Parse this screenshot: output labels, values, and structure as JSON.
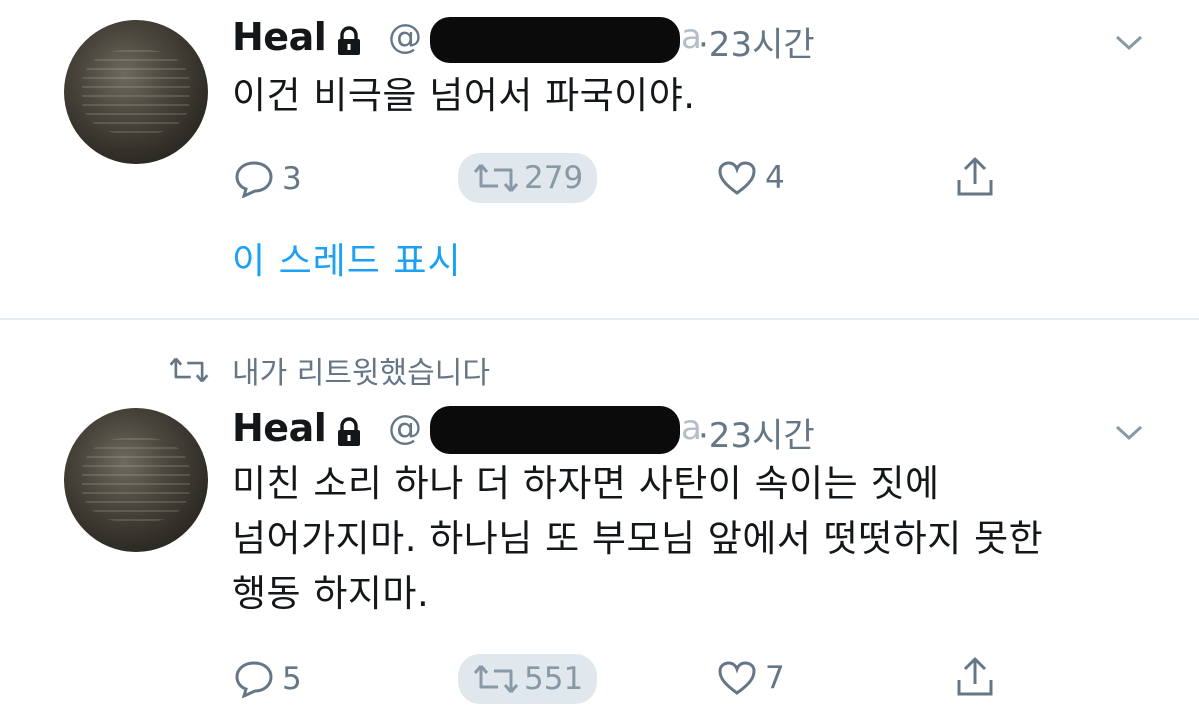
{
  "tweets": [
    {
      "author_name": "Heal",
      "handle_prefix": "@",
      "handle_visible_end": "a",
      "time": "·23시간",
      "text": "이건 비극을 넘어서 파국이야.",
      "replies": "3",
      "retweets": "279",
      "likes": "4",
      "show_thread": "이 스레드 표시"
    },
    {
      "retweet_notice": "내가 리트윗했습니다",
      "author_name": "Heal",
      "handle_prefix": "@",
      "handle_visible_end": "a",
      "time": "·23시간",
      "text_lines": [
        "미친 소리 하나 더 하자면 사탄이 속이는 짓에",
        "넘어가지마. 하나님 또 부모님 앞에서 떳떳하지 못한",
        "행동 하지마."
      ],
      "replies": "5",
      "retweets": "551",
      "likes": "7"
    }
  ],
  "colors": {
    "link": "#1da1f2",
    "secondary": "#657786",
    "retweet_pill": "#e1e8ed"
  },
  "icons": [
    "lock-icon",
    "chevron-down-icon",
    "reply-icon",
    "retweet-icon",
    "like-icon",
    "share-icon"
  ]
}
